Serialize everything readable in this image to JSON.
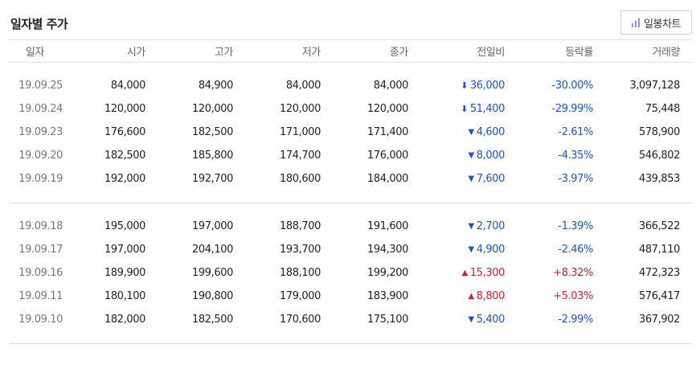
{
  "title": "일자별 주가",
  "chart_button_label": "일봉차트",
  "colors": {
    "down": "#1a56c8",
    "up": "#d8202a",
    "icon": "#9b8ad8"
  },
  "columns": [
    "일자",
    "시가",
    "고가",
    "저가",
    "종가",
    "전일비",
    "등락률",
    "거래량"
  ],
  "rows": [
    {
      "date": "19.09.25",
      "open": "84,000",
      "high": "84,900",
      "low": "84,000",
      "close": "84,000",
      "change": "36,000",
      "change_dir": "limit-down",
      "rate": "-30.00%",
      "volume": "3,097,128"
    },
    {
      "date": "19.09.24",
      "open": "120,000",
      "high": "120,000",
      "low": "120,000",
      "close": "120,000",
      "change": "51,400",
      "change_dir": "limit-down",
      "rate": "-29.99%",
      "volume": "75,448"
    },
    {
      "date": "19.09.23",
      "open": "176,600",
      "high": "182,500",
      "low": "171,000",
      "close": "171,400",
      "change": "4,600",
      "change_dir": "down",
      "rate": "-2.61%",
      "volume": "578,900"
    },
    {
      "date": "19.09.20",
      "open": "182,500",
      "high": "185,800",
      "low": "174,700",
      "close": "176,000",
      "change": "8,000",
      "change_dir": "down",
      "rate": "-4.35%",
      "volume": "546,802"
    },
    {
      "date": "19.09.19",
      "open": "192,000",
      "high": "192,700",
      "low": "180,600",
      "close": "184,000",
      "change": "7,600",
      "change_dir": "down",
      "rate": "-3.97%",
      "volume": "439,853"
    },
    {
      "date": "19.09.18",
      "open": "195,000",
      "high": "197,000",
      "low": "188,700",
      "close": "191,600",
      "change": "2,700",
      "change_dir": "down",
      "rate": "-1.39%",
      "volume": "366,522"
    },
    {
      "date": "19.09.17",
      "open": "197,000",
      "high": "204,100",
      "low": "193,700",
      "close": "194,300",
      "change": "4,900",
      "change_dir": "down",
      "rate": "-2.46%",
      "volume": "487,110"
    },
    {
      "date": "19.09.16",
      "open": "189,900",
      "high": "199,600",
      "low": "188,100",
      "close": "199,200",
      "change": "15,300",
      "change_dir": "up",
      "rate": "+8.32%",
      "volume": "472,323"
    },
    {
      "date": "19.09.11",
      "open": "180,100",
      "high": "190,800",
      "low": "179,000",
      "close": "183,900",
      "change": "8,800",
      "change_dir": "up",
      "rate": "+5.03%",
      "volume": "576,417"
    },
    {
      "date": "19.09.10",
      "open": "182,000",
      "high": "182,500",
      "low": "170,600",
      "close": "175,100",
      "change": "5,400",
      "change_dir": "down",
      "rate": "-2.99%",
      "volume": "367,902"
    }
  ]
}
